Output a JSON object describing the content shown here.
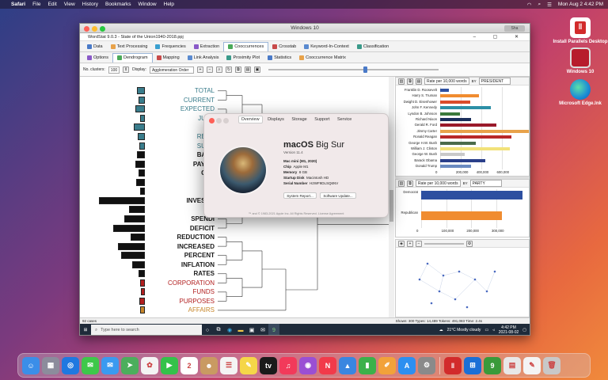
{
  "menubar": {
    "apple": "",
    "app": "Safari",
    "items": [
      "File",
      "Edit",
      "View",
      "History",
      "Bookmarks",
      "Window",
      "Help"
    ],
    "clock": "Mon Aug 2  4:42 PM"
  },
  "desktop": {
    "icons": [
      {
        "label": "Install Parallels Desktop",
        "color": "#d22b2b"
      },
      {
        "label": "Windows 10",
        "color": "#b71c2c"
      },
      {
        "label": "Microsoft Edge.lnk",
        "color": "#1b8bd6"
      }
    ]
  },
  "vm": {
    "title": "Windows 10",
    "share_label": "Sha",
    "app_title": "WordStat 9.0.3 - State of the Union1940-2018.ppj",
    "win_controls": "– ▢ ✕",
    "tabs_main": [
      "Data",
      "Text Processing",
      "Frequencies",
      "Extraction",
      "Cooccurrences",
      "Crosstab",
      "Keyword-In-Context",
      "Classification"
    ],
    "tabs_main_active": 4,
    "tabs_sub": [
      "Options",
      "Dendrogram",
      "Mapping",
      "Link Analysis",
      "Proximity Plot",
      "Statistics",
      "Cooccurrence Matrix"
    ],
    "tabs_sub_active": 1,
    "options": {
      "clusters_label": "No. clusters:",
      "clusters_value": "100",
      "display_label": "Display:",
      "display_value": "Agglomeration Order"
    },
    "dendrogram": {
      "words": [
        {
          "text": "TOTAL",
          "color": "#3a7d8c",
          "bold": false,
          "bar": 10
        },
        {
          "text": "CURRENT",
          "color": "#3a7d8c",
          "bold": false,
          "bar": 8
        },
        {
          "text": "EXPECTED",
          "color": "#3a7d8c",
          "bold": false,
          "bar": 12
        },
        {
          "text": "JUNE",
          "color": "#3a7d8c",
          "bold": false,
          "bar": 6
        },
        {
          "text": "D",
          "color": "#3a7d8c",
          "bold": false,
          "bar": 14
        },
        {
          "text": "RECE",
          "color": "#3a7d8c",
          "bold": false,
          "bar": 9
        },
        {
          "text": "SURP",
          "color": "#3a7d8c",
          "bold": false,
          "bar": 7
        },
        {
          "text": "BALA",
          "color": "#1a1a1a",
          "bold": true,
          "bar": 10
        },
        {
          "text": "PAYME",
          "color": "#1a1a1a",
          "bold": true,
          "bar": 12
        },
        {
          "text": "CRE",
          "color": "#1a1a1a",
          "bold": true,
          "bar": 8
        },
        {
          "text": "CU",
          "color": "#1a1a1a",
          "bold": true,
          "bar": 11
        },
        {
          "text": "T",
          "color": "#1a1a1a",
          "bold": true,
          "bar": 6
        },
        {
          "text": "INVESTM",
          "color": "#1a1a1a",
          "bold": true,
          "bar": 58
        },
        {
          "text": "O",
          "color": "#1a1a1a",
          "bold": true,
          "bar": 20
        },
        {
          "text": "SPENDI",
          "color": "#1a1a1a",
          "bold": true,
          "bar": 26
        },
        {
          "text": "DEFICIT",
          "color": "#1a1a1a",
          "bold": true,
          "bar": 40
        },
        {
          "text": "REDUCTION",
          "color": "#1a1a1a",
          "bold": true,
          "bar": 18
        },
        {
          "text": "INCREASED",
          "color": "#1a1a1a",
          "bold": true,
          "bar": 34
        },
        {
          "text": "PERCENT",
          "color": "#1a1a1a",
          "bold": true,
          "bar": 30
        },
        {
          "text": "INFLATION",
          "color": "#1a1a1a",
          "bold": true,
          "bar": 16
        },
        {
          "text": "RATES",
          "color": "#1a1a1a",
          "bold": true,
          "bar": 8
        },
        {
          "text": "CORPORATION",
          "color": "#b21f1f",
          "bold": false,
          "bar": 6
        },
        {
          "text": "FUNDS",
          "color": "#b21f1f",
          "bold": false,
          "bar": 5
        },
        {
          "text": "PURPOSES",
          "color": "#b21f1f",
          "bold": false,
          "bar": 7
        },
        {
          "text": "AFFAIRS",
          "color": "#c7862a",
          "bold": false,
          "bar": 6
        }
      ]
    },
    "top_chart": {
      "metric": "Rate per 10,000 words",
      "by_label": "BY",
      "by_value": "PRESIDENT",
      "max": 800000,
      "ticks": [
        "0",
        "200,000",
        "400,000",
        "600,000"
      ],
      "bars": [
        {
          "name": "Franklin D. Roosevelt",
          "value": 80000,
          "color": "#2d4fa0"
        },
        {
          "name": "Harry S. Truman",
          "value": 350000,
          "color": "#f08c30"
        },
        {
          "name": "Dwight D. Eisenhower",
          "value": 270000,
          "color": "#d94c2b"
        },
        {
          "name": "John F. Kennedy",
          "value": 460000,
          "color": "#2c8fa6"
        },
        {
          "name": "Lyndon B. Johnson",
          "value": 180000,
          "color": "#3b7a3b"
        },
        {
          "name": "Richard Nixon",
          "value": 280000,
          "color": "#1a2e5a"
        },
        {
          "name": "Gerald R. Ford",
          "value": 510000,
          "color": "#9a1a2a"
        },
        {
          "name": "Jimmy Carter",
          "value": 860000,
          "color": "#e8a24a"
        },
        {
          "name": "Ronald Reagan",
          "value": 640000,
          "color": "#b82828"
        },
        {
          "name": "George H.W. Bush",
          "value": 320000,
          "color": "#4a6a4a"
        },
        {
          "name": "William J. Clinton",
          "value": 630000,
          "color": "#f2e27a"
        },
        {
          "name": "George W. Bush",
          "value": 220000,
          "color": "#c9c9c9"
        },
        {
          "name": "Barack Obama",
          "value": 410000,
          "color": "#2a3f8a"
        },
        {
          "name": "Donald Trump",
          "value": 280000,
          "color": "#6a8ac0"
        }
      ]
    },
    "bottom_chart": {
      "metric": "Rate per 10,000 words",
      "by_label": "BY",
      "by_value": "PARTY",
      "max": 350000,
      "ticks": [
        "0",
        "100,000",
        "200,000",
        "300,000"
      ],
      "bars": [
        {
          "name": "Democrat",
          "value": 340000,
          "color": "#2d4fa0"
        },
        {
          "name": "Republican",
          "value": 270000,
          "color": "#f08c30"
        }
      ]
    },
    "status": {
      "left": "92 cases",
      "right": "Shown: 300    Types: 14,489    Tokens: 491,083    Time: 2.4s"
    }
  },
  "taskbar": {
    "search_placeholder": "Type here to search",
    "weather": "21°C  Mostly cloudy",
    "time": "4:42 PM",
    "date": "2021-08-02"
  },
  "about": {
    "tabs": [
      "Overview",
      "Displays",
      "Storage",
      "Support",
      "Service"
    ],
    "active_tab": 0,
    "os_name_bold": "macOS",
    "os_name_rest": "Big Sur",
    "version": "Version 11.4",
    "specs": [
      {
        "k": "Mac mini (M1, 2020)",
        "v": ""
      },
      {
        "k": "Chip",
        "v": "Apple M1"
      },
      {
        "k": "Memory",
        "v": "8 GB"
      },
      {
        "k": "Startup Disk",
        "v": "Macintosh HD"
      },
      {
        "k": "Serial Number",
        "v": "H2WF9DLSQ6NV"
      }
    ],
    "btn_report": "System Report...",
    "btn_update": "Software Update...",
    "copyright": "™ and © 1983-2021 Apple Inc. All Rights Reserved. License Agreement"
  },
  "dock": {
    "apps": [
      {
        "name": "Finder",
        "color": "#3b8ee8",
        "glyph": "☺"
      },
      {
        "name": "Launchpad",
        "color": "#8c8c9c",
        "glyph": "▦"
      },
      {
        "name": "Safari",
        "color": "#1f78e0",
        "glyph": "◎"
      },
      {
        "name": "Messages",
        "color": "#3ec84a",
        "glyph": "✉"
      },
      {
        "name": "Mail",
        "color": "#3a9af0",
        "glyph": "✉"
      },
      {
        "name": "Maps",
        "color": "#4cae5c",
        "glyph": "➤"
      },
      {
        "name": "Photos",
        "color": "#f4f4f4",
        "glyph": "✿"
      },
      {
        "name": "FaceTime",
        "color": "#34c24a",
        "glyph": "▶"
      },
      {
        "name": "Calendar",
        "color": "#ffffff",
        "glyph": "2"
      },
      {
        "name": "Contacts",
        "color": "#c99a62",
        "glyph": "☻"
      },
      {
        "name": "Reminders",
        "color": "#f4f4f4",
        "glyph": "☰"
      },
      {
        "name": "Notes",
        "color": "#f5d648",
        "glyph": "✎"
      },
      {
        "name": "TV",
        "color": "#1a1a1a",
        "glyph": "tv"
      },
      {
        "name": "Music",
        "color": "#f23a5a",
        "glyph": "♫"
      },
      {
        "name": "Podcasts",
        "color": "#9a4fd4",
        "glyph": "◉"
      },
      {
        "name": "News",
        "color": "#f23a4a",
        "glyph": "N"
      },
      {
        "name": "Keynote",
        "color": "#3a86e0",
        "glyph": "▲"
      },
      {
        "name": "Numbers",
        "color": "#3cb14a",
        "glyph": "▮"
      },
      {
        "name": "Pages",
        "color": "#f2a23a",
        "glyph": "✐"
      },
      {
        "name": "App Store",
        "color": "#2d8ff0",
        "glyph": "A"
      },
      {
        "name": "System Preferences",
        "color": "#8a8a8a",
        "glyph": "⚙"
      },
      {
        "name": "Parallels Desktop",
        "color": "#d22b2b",
        "glyph": "‖"
      },
      {
        "name": "Windows 10",
        "color": "#1b6fd6",
        "glyph": "⊞"
      },
      {
        "name": "WordStat",
        "color": "#3a9a3a",
        "glyph": "9"
      },
      {
        "name": "Preview",
        "color": "#e8e8e8",
        "glyph": "▤"
      },
      {
        "name": "TextEdit",
        "color": "#f4f4f4",
        "glyph": "✎"
      },
      {
        "name": "Trash",
        "color": "#c8c8c8",
        "glyph": "🗑"
      }
    ]
  }
}
